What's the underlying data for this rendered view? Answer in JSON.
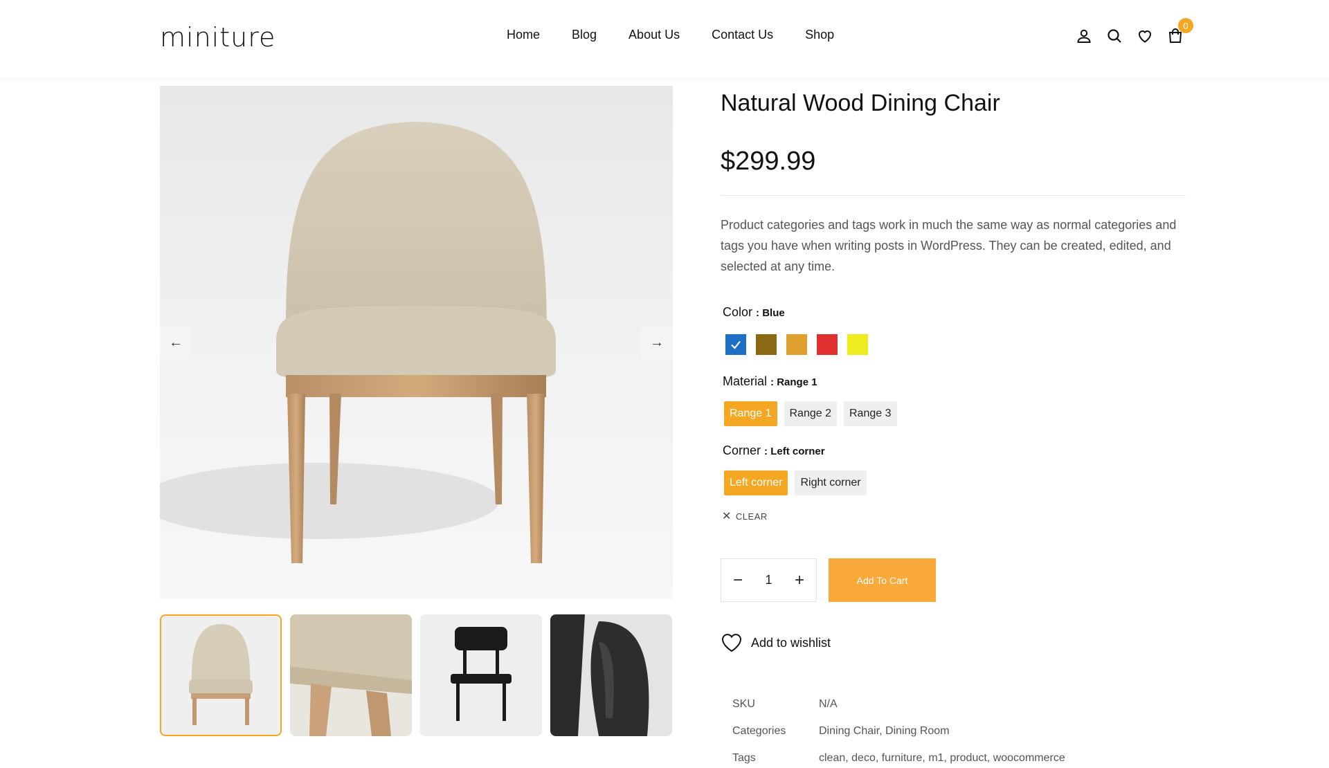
{
  "header": {
    "logo": "miniture",
    "nav": [
      "Home",
      "Blog",
      "About Us",
      "Contact Us",
      "Shop"
    ],
    "icons": [
      "user-icon",
      "search-icon",
      "heart-icon",
      "bag-icon"
    ],
    "cart_count": "0"
  },
  "gallery": {
    "prev_arrow": "←",
    "next_arrow": "→",
    "thumbnails": [
      "beige-chair-front",
      "beige-chair-closeup",
      "black-chair",
      "black-chair-closeup"
    ]
  },
  "product": {
    "title": "Natural Wood Dining Chair",
    "price": "$299.99",
    "description": "Product categories and tags work in much the same way as normal categories and tags you have when writing posts in WordPress. They can be created, edited, and selected at any time.",
    "color": {
      "label": "Color",
      "selected": ": Blue",
      "swatches": [
        "#1e6ec4",
        "#8b6914",
        "#e0a030",
        "#e03030",
        "#ecec20"
      ]
    },
    "material": {
      "label": "Material",
      "selected": ": Range 1",
      "options": [
        "Range 1",
        "Range 2",
        "Range 3"
      ]
    },
    "corner": {
      "label": "Corner",
      "selected": ": Left corner",
      "options": [
        "Left corner",
        "Right corner"
      ]
    },
    "clear_label": "CLEAR",
    "quantity": "1",
    "add_to_cart": "Add To Cart",
    "wishlist": "Add to wishlist",
    "meta": {
      "sku_label": "SKU",
      "sku": "N/A",
      "categories_label": "Categories",
      "categories": "Dining Chair, Dining Room",
      "tags_label": "Tags",
      "tags": "clean, deco, furniture, m1, product, woocommerce"
    }
  },
  "colors": {
    "accent": "#f5a623"
  }
}
